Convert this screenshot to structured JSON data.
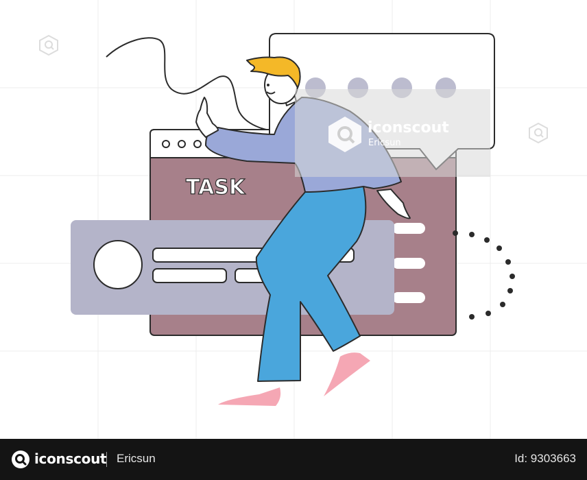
{
  "illustration": {
    "task_label": "TASK",
    "colors": {
      "task_window": "#a7808a",
      "profile_card": "#b4b4c9",
      "shirt": "#9aa8d8",
      "pants": "#4aa6dc",
      "hair": "#f4b828",
      "shoes": "#f5a7b4",
      "skin": "#ffffff",
      "outline": "#2b2b2b"
    }
  },
  "watermark": {
    "brand": "iconscout",
    "author": "Ericsun"
  },
  "footer": {
    "brand": "iconscout",
    "author": "Ericsun",
    "asset_id": "Id: 9303663"
  }
}
